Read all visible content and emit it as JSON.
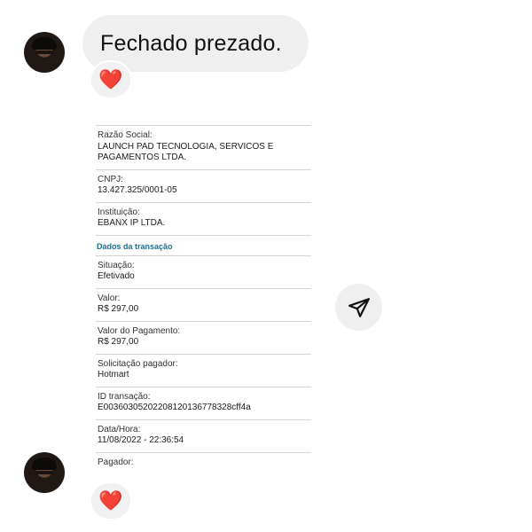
{
  "message": {
    "text": "Fechado prezado."
  },
  "reactions": {
    "emoji": "❤️"
  },
  "receipt": {
    "fields_top": [
      {
        "label": "Razão Social:",
        "value": "LAUNCH PAD TECNOLOGIA, SERVICOS E PAGAMENTOS LTDA."
      },
      {
        "label": "CNPJ:",
        "value": "13.427.325/0001-05"
      },
      {
        "label": "Instituição:",
        "value": "EBANX IP LTDA."
      }
    ],
    "section_title": "Dados da transação",
    "fields_bottom": [
      {
        "label": "Situação:",
        "value": "Efetivado"
      },
      {
        "label": "Valor:",
        "value": "R$ 297,00"
      },
      {
        "label": "Valor do Pagamento:",
        "value": "R$ 297,00"
      },
      {
        "label": "Solicitação pagador:",
        "value": "Hotmart"
      },
      {
        "label": "ID transação:",
        "value": "E00360305202208120136778328cff4a"
      },
      {
        "label": "Data/Hora:",
        "value": "11/08/2022 - 22:36:54"
      },
      {
        "label": "Pagador:",
        "value": ""
      }
    ]
  },
  "colors": {
    "heart": "#e0142e",
    "bubble": "#efefef",
    "section": "#1f6f93"
  }
}
